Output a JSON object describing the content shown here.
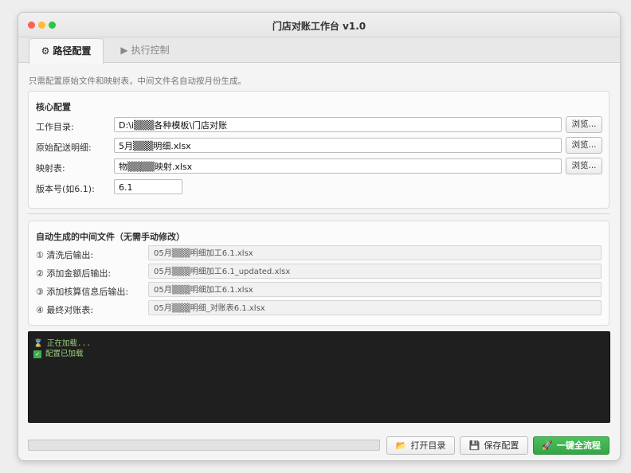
{
  "window": {
    "title": "门店对账工作台 v1.0"
  },
  "tabs": [
    {
      "icon": "gear-icon",
      "glyph": "⚙",
      "label": "路径配置",
      "active": true
    },
    {
      "icon": "play-icon",
      "glyph": "▶",
      "label": "执行控制",
      "active": false
    }
  ],
  "hint": "只需配置原始文件和映射表，中间文件名自动按月份生成。",
  "core": {
    "title": "核心配置",
    "browse_label": "浏览...",
    "rows": [
      {
        "label": "工作目录:",
        "value": "D:\\i▒▒▒各种模板\\门店对账"
      },
      {
        "label": "原始配送明细:",
        "value": "5月▒▒▒明细.xlsx"
      },
      {
        "label": "映射表:",
        "value": "物▒▒▒▒映射.xlsx"
      }
    ],
    "version": {
      "label": "版本号(如6.1):",
      "value": "6.1"
    }
  },
  "auto": {
    "title": "自动生成的中间文件（无需手动修改）",
    "rows": [
      {
        "label": "① 清洗后输出:",
        "value": "05月▒▒▒明细加工6.1.xlsx"
      },
      {
        "label": "② 添加金额后输出:",
        "value": "05月▒▒▒明细加工6.1_updated.xlsx"
      },
      {
        "label": "③ 添加核算信息后输出:",
        "value": "05月▒▒▒明细加工6.1.xlsx"
      },
      {
        "label": "④ 最终对账表:",
        "value": "05月▒▒▒明细_对账表6.1.xlsx"
      }
    ]
  },
  "console": {
    "lines": [
      {
        "icon": "hourglass-icon",
        "glyph": "⌛",
        "text": "正在加载..."
      },
      {
        "icon": "check-icon",
        "glyph": "✓",
        "text": "配置已加载"
      }
    ]
  },
  "footer": {
    "progress": 0,
    "open_dir": {
      "icon": "folder-icon",
      "glyph": "📂",
      "label": "打开目录"
    },
    "save_config": {
      "icon": "save-icon",
      "glyph": "💾",
      "label": "保存配置"
    },
    "run_all": {
      "icon": "rocket-icon",
      "glyph": "🚀",
      "label": "一键全流程"
    }
  },
  "colors": {
    "accent_green": "#3db04d",
    "console_bg": "#1f1f1f",
    "console_text": "#9bd27a"
  }
}
